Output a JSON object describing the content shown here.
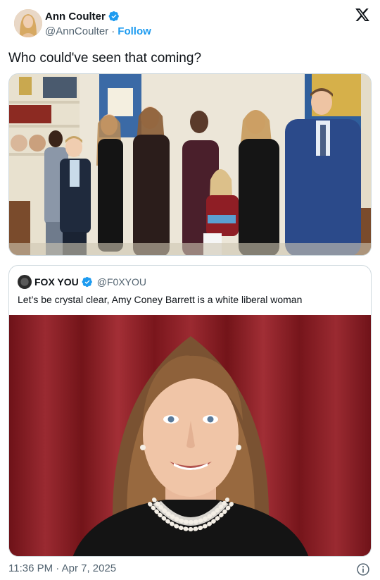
{
  "author": {
    "name": "Ann Coulter",
    "handle": "@AnnCoulter",
    "separator": "·",
    "follow_label": "Follow",
    "verified_icon": "verified-badge-icon"
  },
  "tweet": {
    "text": "Who could've seen that coming?",
    "timestamp": "11:36 PM · Apr 7, 2025"
  },
  "quoted": {
    "name": "FOX YOU",
    "handle": "@F0XYOU",
    "text": "Let’s be crystal clear, Amy Coney Barrett is a white liberal woman"
  },
  "colors": {
    "link_blue": "#1d9bf0",
    "muted_text": "#536471",
    "border": "#cfd9de",
    "text": "#0f1419"
  }
}
